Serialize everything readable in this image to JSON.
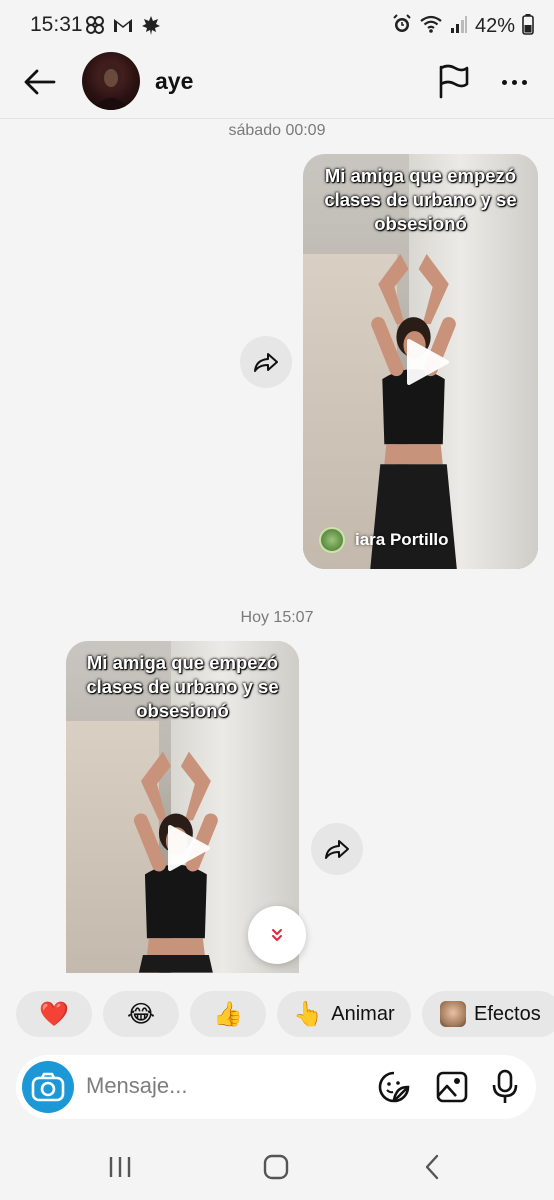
{
  "status_bar": {
    "time": "15:31",
    "left_icons": [
      "pinwheel-icon",
      "gmail-icon",
      "maple-leaf-icon"
    ],
    "right_icons": [
      "alarm-icon",
      "wifi-icon",
      "signal-icon",
      "battery-icon"
    ],
    "battery": "42%"
  },
  "header": {
    "back_icon": "arrow-left-icon",
    "username": "aye",
    "flag_icon": "flag-icon",
    "more_icon": "more-horizontal-icon"
  },
  "messages": [
    {
      "timestamp": "sábado 00:09",
      "direction": "sent",
      "type": "reel",
      "caption": "Mi amiga que empezó clases de urbano y se obsesionó",
      "author": "iara Portillo"
    },
    {
      "timestamp": "Hoy 15:07",
      "direction": "received",
      "type": "reel",
      "caption": "Mi amiga que empezó clases de urbano y se obsesionó"
    }
  ],
  "reactions": [
    {
      "emoji": "❤️"
    },
    {
      "emoji": "😂"
    },
    {
      "emoji": "👍"
    },
    {
      "emoji": "👆",
      "label": "Animar"
    },
    {
      "label": "Efectos"
    }
  ],
  "composer": {
    "placeholder": "Mensaje...",
    "icons": [
      "camera-icon",
      "sticker-icon",
      "gallery-icon",
      "microphone-icon"
    ]
  },
  "colors": {
    "accent": "#1c98d6",
    "heart": "#e3243b",
    "background": "#f4f4f4"
  }
}
